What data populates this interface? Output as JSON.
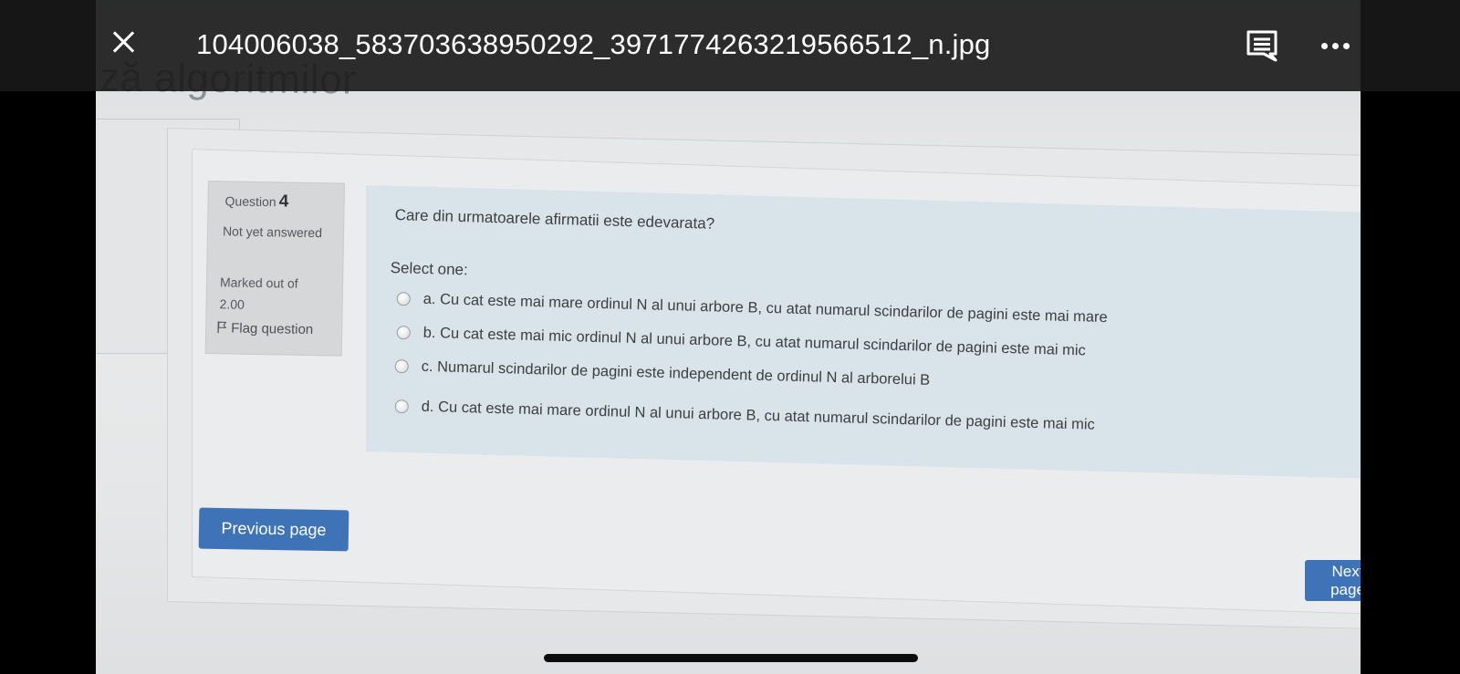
{
  "viewer": {
    "filename": "104006038_583703638950292_3971774263219566512_n.jpg",
    "close_icon": "close-icon",
    "comments_icon": "comment-icon",
    "more_icon": "more-horizontal-icon"
  },
  "page": {
    "background_heading": "ză algoritmilor"
  },
  "question_info": {
    "label": "Question",
    "number": "4",
    "state": "Not yet answered",
    "marked_label": "Marked out of",
    "marked_value": "2.00",
    "flag_label": "Flag question"
  },
  "question": {
    "text": "Care din urmatoarele afirmatii este edevarata?",
    "prompt": "Select one:",
    "answers": [
      "a. Cu cat este mai mare ordinul N al unui arbore B, cu atat numarul scindarilor de pagini este mai mare",
      "b. Cu cat este mai mic ordinul N al unui arbore B, cu atat numarul scindarilor de pagini este mai mic",
      "c. Numarul scindarilor de pagini este independent de ordinul N al arborelui B",
      "d. Cu cat este mai mare ordinul N al unui arbore B, cu atat numarul scindarilor de pagini este mai mic"
    ]
  },
  "navigation": {
    "previous_label": "Previous page",
    "next_label": "Next page"
  },
  "colors": {
    "primary_button": "#3f73b8",
    "question_bg": "#d8e4e9",
    "info_bg": "#d6d7d8"
  }
}
